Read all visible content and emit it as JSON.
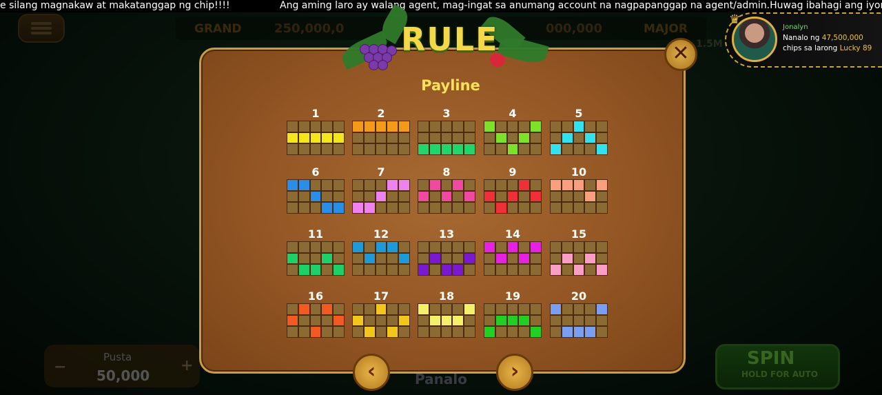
{
  "ticker": {
    "left": "e silang magnakaw at makatanggap ng chip!!!!",
    "right": "Ang aming laro ay walang agent, mag-ingat sa anumang account na nagpapanggap na agent/admin.Huwag ibahagi ang iyong OTP LAROPAY"
  },
  "jackpot": {
    "grand_label": "GRAND",
    "grand_value": "250,000,0",
    "major_value": "000,000",
    "major_label": "MAJOR",
    "right_value": "1.5M"
  },
  "winner": {
    "name": "Jonalyn",
    "prefix": "Nanalo ng",
    "amount": "47,500,000",
    "mid": "chips sa larong",
    "game": "Lucky 89"
  },
  "modal": {
    "title": "RULE",
    "heading": "Payline",
    "close_symbol": "✕",
    "prev_symbol": "‹",
    "next_symbol": "›"
  },
  "paylines": [
    {
      "label": "1",
      "color": "#f5e61b",
      "cells": [
        [
          1,
          0
        ],
        [
          1,
          1
        ],
        [
          1,
          2
        ],
        [
          1,
          3
        ],
        [
          1,
          4
        ]
      ]
    },
    {
      "label": "2",
      "color": "#f39a1a",
      "cells": [
        [
          0,
          0
        ],
        [
          0,
          1
        ],
        [
          0,
          2
        ],
        [
          0,
          3
        ],
        [
          0,
          4
        ]
      ]
    },
    {
      "label": "3",
      "color": "#22d66e",
      "cells": [
        [
          2,
          0
        ],
        [
          2,
          1
        ],
        [
          2,
          2
        ],
        [
          2,
          3
        ],
        [
          2,
          4
        ]
      ]
    },
    {
      "label": "4",
      "color": "#7ee02a",
      "cells": [
        [
          0,
          0
        ],
        [
          1,
          1
        ],
        [
          2,
          2
        ],
        [
          1,
          3
        ],
        [
          0,
          4
        ]
      ]
    },
    {
      "label": "5",
      "color": "#33e0ee",
      "cells": [
        [
          2,
          0
        ],
        [
          1,
          1
        ],
        [
          0,
          2
        ],
        [
          1,
          3
        ],
        [
          2,
          4
        ]
      ]
    },
    {
      "label": "6",
      "color": "#2a8ee8",
      "cells": [
        [
          0,
          0
        ],
        [
          0,
          1
        ],
        [
          1,
          2
        ],
        [
          2,
          3
        ],
        [
          2,
          4
        ]
      ]
    },
    {
      "label": "7",
      "color": "#ee82ee",
      "cells": [
        [
          2,
          0
        ],
        [
          2,
          1
        ],
        [
          1,
          2
        ],
        [
          0,
          3
        ],
        [
          0,
          4
        ]
      ]
    },
    {
      "label": "8",
      "color": "#f04aa0",
      "cells": [
        [
          1,
          0
        ],
        [
          0,
          1
        ],
        [
          1,
          2
        ],
        [
          0,
          3
        ],
        [
          1,
          4
        ]
      ]
    },
    {
      "label": "9",
      "color": "#ef3038",
      "cells": [
        [
          1,
          0
        ],
        [
          2,
          1
        ],
        [
          1,
          2
        ],
        [
          0,
          3
        ],
        [
          1,
          4
        ]
      ]
    },
    {
      "label": "10",
      "color": "#fa9e80",
      "cells": [
        [
          0,
          0
        ],
        [
          0,
          1
        ],
        [
          0,
          2
        ],
        [
          1,
          3
        ],
        [
          0,
          4
        ]
      ]
    },
    {
      "label": "11",
      "color": "#1ed06a",
      "cells": [
        [
          1,
          0
        ],
        [
          2,
          1
        ],
        [
          2,
          2
        ],
        [
          1,
          3
        ],
        [
          2,
          4
        ]
      ]
    },
    {
      "label": "12",
      "color": "#1e9ad8",
      "cells": [
        [
          0,
          0
        ],
        [
          1,
          1
        ],
        [
          0,
          2
        ],
        [
          0,
          3
        ],
        [
          1,
          4
        ]
      ]
    },
    {
      "label": "13",
      "color": "#7a1ad0",
      "cells": [
        [
          2,
          0
        ],
        [
          1,
          1
        ],
        [
          2,
          2
        ],
        [
          2,
          3
        ],
        [
          1,
          4
        ]
      ]
    },
    {
      "label": "14",
      "color": "#e322e3",
      "cells": [
        [
          0,
          0
        ],
        [
          1,
          1
        ],
        [
          0,
          2
        ],
        [
          1,
          3
        ],
        [
          0,
          4
        ]
      ]
    },
    {
      "label": "15",
      "color": "#fa9ec6",
      "cells": [
        [
          2,
          0
        ],
        [
          1,
          1
        ],
        [
          2,
          2
        ],
        [
          1,
          3
        ],
        [
          2,
          4
        ]
      ]
    },
    {
      "label": "16",
      "color": "#f35a22",
      "cells": [
        [
          1,
          0
        ],
        [
          0,
          1
        ],
        [
          2,
          2
        ],
        [
          0,
          3
        ],
        [
          1,
          4
        ]
      ]
    },
    {
      "label": "17",
      "color": "#f2c61a",
      "cells": [
        [
          1,
          0
        ],
        [
          2,
          1
        ],
        [
          0,
          2
        ],
        [
          2,
          3
        ],
        [
          1,
          4
        ]
      ]
    },
    {
      "label": "18",
      "color": "#f5f06a",
      "cells": [
        [
          0,
          0
        ],
        [
          1,
          1
        ],
        [
          1,
          2
        ],
        [
          1,
          3
        ],
        [
          0,
          4
        ]
      ]
    },
    {
      "label": "19",
      "color": "#22cf22",
      "cells": [
        [
          2,
          0
        ],
        [
          1,
          1
        ],
        [
          1,
          2
        ],
        [
          1,
          3
        ],
        [
          2,
          4
        ]
      ]
    },
    {
      "label": "20",
      "color": "#7a9ff2",
      "cells": [
        [
          0,
          0
        ],
        [
          2,
          1
        ],
        [
          2,
          2
        ],
        [
          2,
          3
        ],
        [
          0,
          4
        ]
      ]
    }
  ],
  "bottom": {
    "bet_label": "Pusta",
    "bet_value": "50,000",
    "minus": "−",
    "plus": "+",
    "win_label": "Panalo",
    "spin_label": "SPIN",
    "spin_sub": "HOLD FOR AUTO"
  }
}
